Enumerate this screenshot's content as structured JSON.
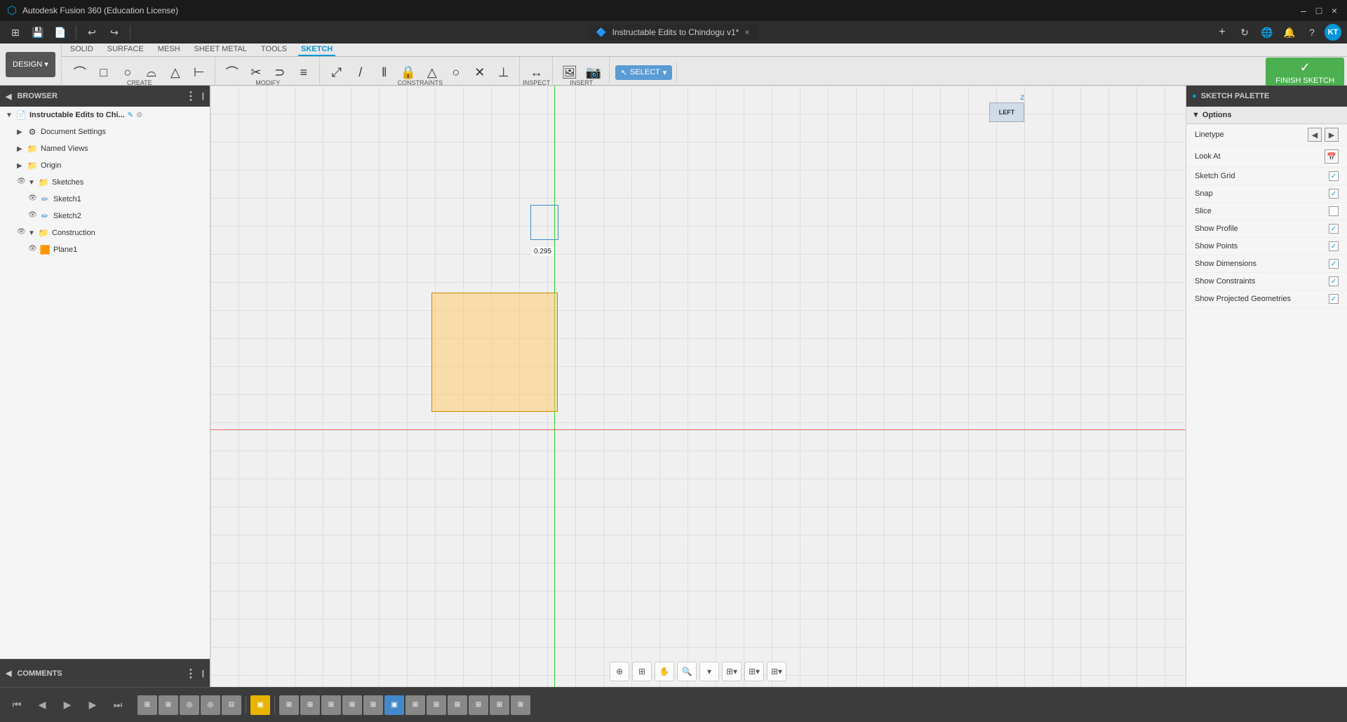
{
  "titleBar": {
    "appName": "Autodesk Fusion 360 (Education License)",
    "minimizeLabel": "–",
    "maximizeLabel": "□",
    "closeLabel": "×"
  },
  "tab": {
    "icon": "🔷",
    "label": "Instructable Edits to Chindogu v1*",
    "closeLabel": "×"
  },
  "toolbarTabs": [
    {
      "id": "solid",
      "label": "SOLID"
    },
    {
      "id": "surface",
      "label": "SURFACE"
    },
    {
      "id": "mesh",
      "label": "MESH"
    },
    {
      "id": "sheetmetal",
      "label": "SHEET METAL"
    },
    {
      "id": "tools",
      "label": "TOOLS"
    },
    {
      "id": "sketch",
      "label": "SKETCH",
      "active": true
    }
  ],
  "toolbarSections": [
    {
      "id": "create",
      "label": "CREATE"
    },
    {
      "id": "modify",
      "label": "MODIFY"
    },
    {
      "id": "constraints",
      "label": "CONSTRAINTS"
    },
    {
      "id": "inspect",
      "label": "INSPECT"
    },
    {
      "id": "insert",
      "label": "INSERT"
    },
    {
      "id": "select",
      "label": "SELECT"
    }
  ],
  "browser": {
    "title": "BROWSER",
    "items": [
      {
        "id": "root",
        "label": "Instructable Edits to Chi...",
        "indent": 0,
        "hasArrow": true,
        "expanded": true,
        "icon": "📄"
      },
      {
        "id": "docSettings",
        "label": "Document Settings",
        "indent": 1,
        "hasArrow": true,
        "icon": "⚙"
      },
      {
        "id": "namedViews",
        "label": "Named Views",
        "indent": 1,
        "hasArrow": true,
        "icon": "📁"
      },
      {
        "id": "origin",
        "label": "Origin",
        "indent": 1,
        "hasArrow": true,
        "icon": "📁"
      },
      {
        "id": "sketches",
        "label": "Sketches",
        "indent": 1,
        "hasArrow": true,
        "expanded": true,
        "icon": "📁"
      },
      {
        "id": "sketch1",
        "label": "Sketch1",
        "indent": 2,
        "hasEye": true,
        "icon": "✏"
      },
      {
        "id": "sketch2",
        "label": "Sketch2",
        "indent": 2,
        "hasEye": true,
        "icon": "✏"
      },
      {
        "id": "construction",
        "label": "Construction",
        "indent": 1,
        "hasArrow": true,
        "expanded": true,
        "icon": "📁"
      },
      {
        "id": "plane1",
        "label": "Plane1",
        "indent": 2,
        "hasEye": true,
        "icon": "🟧"
      }
    ]
  },
  "comments": {
    "title": "COMMENTS"
  },
  "viewport": {
    "dimension": "0.295"
  },
  "navCube": {
    "face": "LEFT"
  },
  "sketchPalette": {
    "title": "SKETCH PALETTE",
    "circleIcon": "●",
    "options": {
      "header": "Options",
      "linetype": "Linetype",
      "lookAt": "Look At",
      "sketchGrid": "Sketch Grid",
      "snap": "Snap",
      "slice": "Slice",
      "showProfile": "Show Profile",
      "showPoints": "Show Points",
      "showDimensions": "Show Dimensions",
      "showConstraints": "Show Constraints",
      "showProjectedGeometries": "Show Projected Geometries",
      "sketchGridChecked": true,
      "snapChecked": true,
      "sliceChecked": false,
      "showProfileChecked": true,
      "showPointsChecked": true,
      "showDimensionsChecked": true,
      "showConstraintsChecked": true,
      "showProjectedGeometriesChecked": true
    }
  },
  "designBtn": {
    "label": "DESIGN ▾"
  },
  "finishSketch": {
    "label": "FINISH SKETCH"
  },
  "bottomNav": {
    "prevLabel": "◀",
    "playBackLabel": "◀",
    "playLabel": "▶",
    "playFwdLabel": "▶",
    "endLabel": "▶▶"
  }
}
